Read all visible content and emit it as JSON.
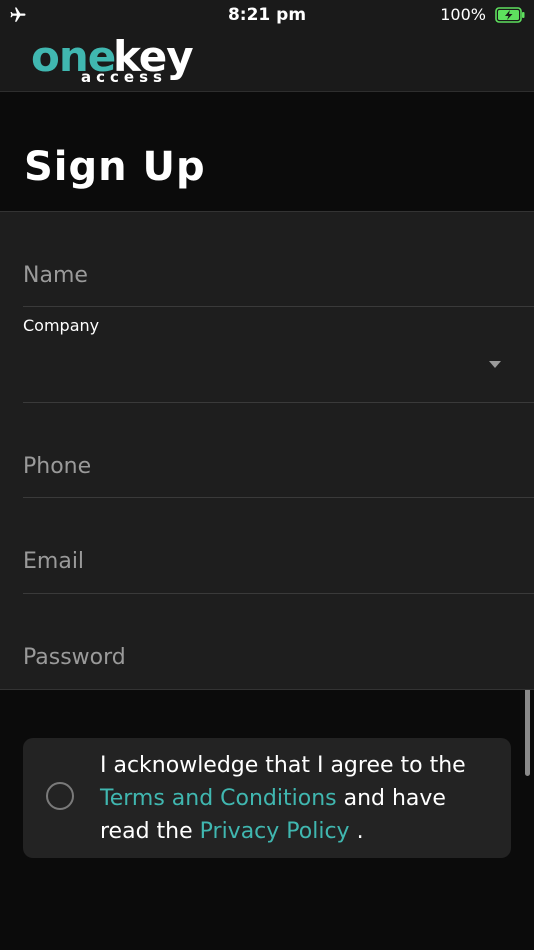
{
  "status_bar": {
    "time": "8:21 pm",
    "battery_percent": "100%",
    "icons": [
      "airplane-icon",
      "battery-charging-icon"
    ]
  },
  "header": {
    "logo": {
      "primary": "one",
      "secondary": "key",
      "tagline": "access"
    }
  },
  "page": {
    "title": "Sign Up"
  },
  "form": {
    "name_placeholder": "Name",
    "company_label": "Company",
    "company_value": "",
    "phone_placeholder": "Phone",
    "email_placeholder": "Email",
    "password_placeholder": "Password"
  },
  "agreement": {
    "text_part1": "I acknowledge that I agree to the",
    "terms_link": "Terms and Conditions",
    "text_part2": "and have read the",
    "privacy_link": "Privacy Policy",
    "text_part3": ".",
    "checked": false
  },
  "colors": {
    "accent": "#40b7b0",
    "background": "#0b0b0b",
    "surface": "#1e1e1e"
  }
}
